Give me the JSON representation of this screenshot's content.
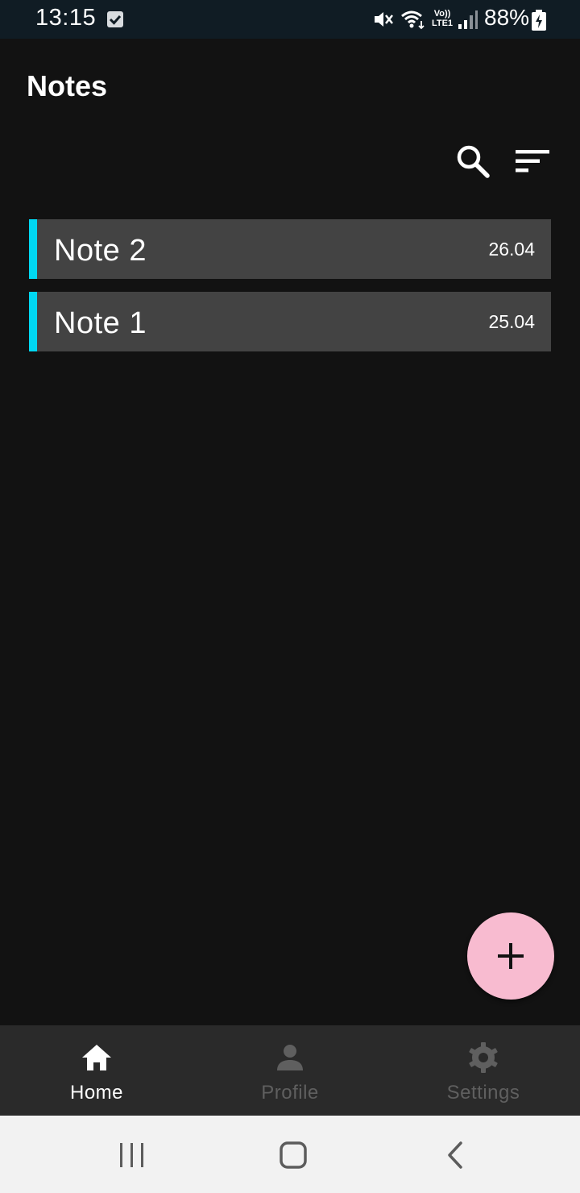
{
  "status_bar": {
    "time": "13:15",
    "lte_top": "Vo))",
    "lte_bottom": "LTE1",
    "battery_percent": "88%"
  },
  "header": {
    "title": "Notes"
  },
  "notes": [
    {
      "title": "Note 2",
      "date": "26.04"
    },
    {
      "title": "Note 1",
      "date": "25.04"
    }
  ],
  "bottom_nav": {
    "items": [
      {
        "label": "Home",
        "icon": "home-icon",
        "active": true
      },
      {
        "label": "Profile",
        "icon": "person-icon",
        "active": false
      },
      {
        "label": "Settings",
        "icon": "gear-icon",
        "active": false
      }
    ]
  },
  "colors": {
    "background": "#121212",
    "note_card": "#434343",
    "note_accent": "#00d7f2",
    "fab": "#f8bbd0",
    "nav_active": "#ffffff",
    "nav_inactive": "#5f5f5f"
  }
}
